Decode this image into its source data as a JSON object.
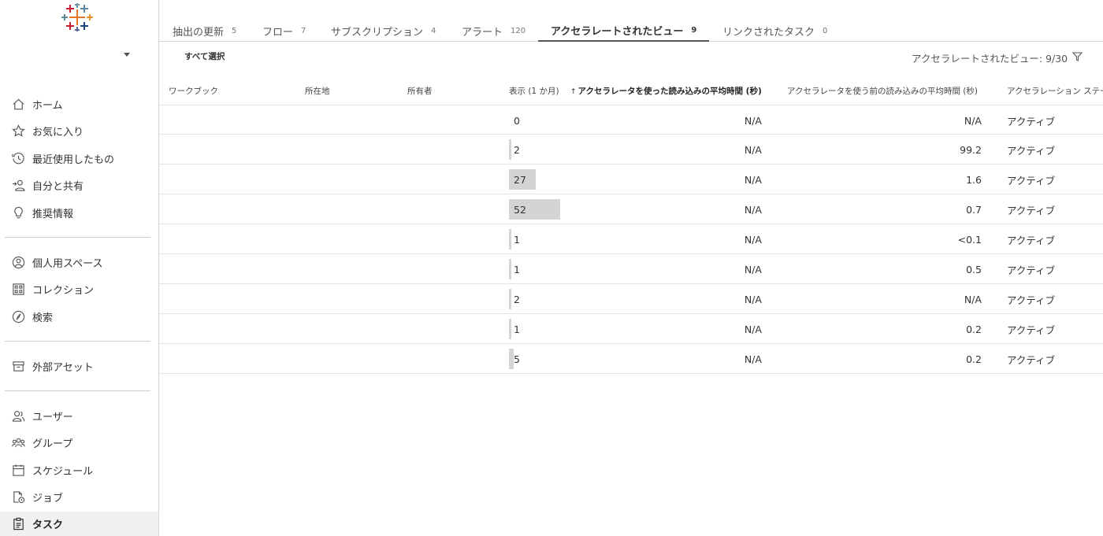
{
  "sidebar": {
    "logo": "tableau-logo-icon",
    "items": [
      {
        "label": "ホーム",
        "icon": "home-icon"
      },
      {
        "label": "お気に入り",
        "icon": "star-icon"
      },
      {
        "label": "最近使用したもの",
        "icon": "clock-history-icon"
      },
      {
        "label": "自分と共有",
        "icon": "shared-users-icon"
      },
      {
        "label": "推奨情報",
        "icon": "lightbulb-icon"
      },
      {
        "label": "個人用スペース",
        "icon": "person-circle-icon"
      },
      {
        "label": "コレクション",
        "icon": "collection-icon"
      },
      {
        "label": "検索",
        "icon": "compass-icon"
      },
      {
        "label": "外部アセット",
        "icon": "archive-box-icon"
      },
      {
        "label": "ユーザー",
        "icon": "user-icon"
      },
      {
        "label": "グループ",
        "icon": "group-icon"
      },
      {
        "label": "スケジュール",
        "icon": "calendar-icon"
      },
      {
        "label": "ジョブ",
        "icon": "job-icon"
      },
      {
        "label": "タスク",
        "icon": "clipboard-icon"
      }
    ],
    "active_item": "タスク"
  },
  "tabs": [
    {
      "label": "抽出の更新",
      "count": "5"
    },
    {
      "label": "フロー",
      "count": "7"
    },
    {
      "label": "サブスクリプション",
      "count": "4"
    },
    {
      "label": "アラート",
      "count": "120"
    },
    {
      "label": "アクセラレートされたビュー",
      "count": "9"
    },
    {
      "label": "リンクされたタスク",
      "count": "0"
    }
  ],
  "active_tab": "アクセラレートされたビュー",
  "toolbar": {
    "select_all": "すべて選択",
    "count_label": "アクセラレートされたビュー: 9/30"
  },
  "table": {
    "columns": [
      "ワークブック",
      "所在地",
      "所有者",
      "表示 (1 か月)",
      "アクセラレータを使った読み込みの平均時間 (秒)",
      "アクセラレータを使う前の読み込みの平均時間 (秒)",
      "アクセラレーション ステータス"
    ],
    "sort_arrow": "↑",
    "views_max": 52,
    "rows": [
      {
        "views": 0,
        "with_accel": "N/A",
        "before_accel": "N/A",
        "status": "アクティブ"
      },
      {
        "views": 2,
        "with_accel": "N/A",
        "before_accel": "99.2",
        "status": "アクティブ"
      },
      {
        "views": 27,
        "with_accel": "N/A",
        "before_accel": "1.6",
        "status": "アクティブ"
      },
      {
        "views": 52,
        "with_accel": "N/A",
        "before_accel": "0.7",
        "status": "アクティブ"
      },
      {
        "views": 1,
        "with_accel": "N/A",
        "before_accel": "<0.1",
        "status": "アクティブ"
      },
      {
        "views": 1,
        "with_accel": "N/A",
        "before_accel": "0.5",
        "status": "アクティブ"
      },
      {
        "views": 2,
        "with_accel": "N/A",
        "before_accel": "N/A",
        "status": "アクティブ"
      },
      {
        "views": 1,
        "with_accel": "N/A",
        "before_accel": "0.2",
        "status": "アクティブ"
      },
      {
        "views": 5,
        "with_accel": "N/A",
        "before_accel": "0.2",
        "status": "アクティブ"
      }
    ]
  }
}
